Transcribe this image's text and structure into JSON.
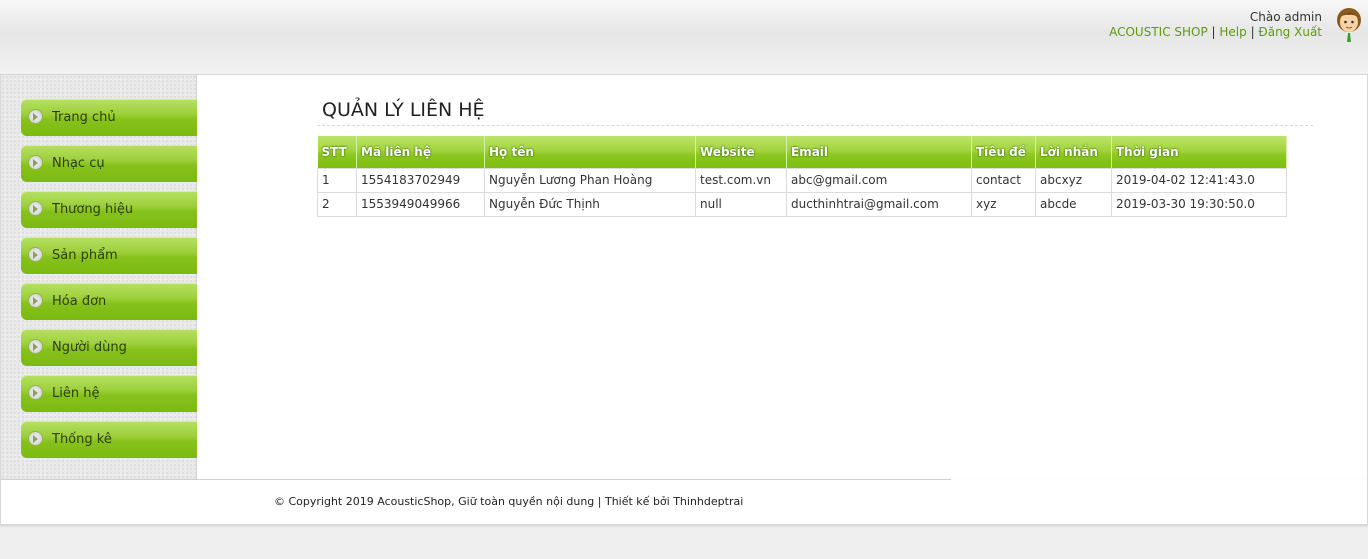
{
  "header": {
    "greeting": "Chào admin",
    "shop_link": "ACOUSTIC SHOP",
    "sep1": " | ",
    "help_link": "Help",
    "sep2": " | ",
    "logout_link": "Đăng Xuất"
  },
  "sidebar": {
    "items": [
      {
        "label": "Trang chủ"
      },
      {
        "label": "Nhạc cụ"
      },
      {
        "label": "Thương hiệu"
      },
      {
        "label": "Sản phẩm"
      },
      {
        "label": "Hóa đơn"
      },
      {
        "label": "Người dùng"
      },
      {
        "label": "Liên hệ"
      },
      {
        "label": "Thống kê"
      }
    ]
  },
  "main": {
    "title": "QUẢN LÝ LIÊN HỆ",
    "table": {
      "headers": [
        "STT",
        "Mã liên hệ",
        "Họ tên",
        "Website",
        "Email",
        "Tiêu đề",
        "Lời nhắn",
        "Thời gian"
      ],
      "rows": [
        [
          "1",
          "1554183702949",
          "Nguyễn Lương Phan Hoàng",
          "test.com.vn",
          "abc@gmail.com",
          "contact",
          "abcxyz",
          "2019-04-02 12:41:43.0"
        ],
        [
          "2",
          "1553949049966",
          "Nguyễn Đức Thịnh",
          "null",
          "ducthinhtrai@gmail.com",
          "xyz",
          "abcde",
          "2019-03-30 19:30:50.0"
        ]
      ]
    }
  },
  "footer": {
    "copyright": "© Copyright 2019 AcousticShop, Giữ toàn quyền nội dung | Thiết kế bởi Thinhdeptrai"
  },
  "colors": {
    "accent_green": "#86c21b",
    "link_green": "#5f9a12"
  },
  "icons": {
    "avatar": "user-avatar-icon",
    "menu_bullet": "chevron-right-circle-icon"
  }
}
